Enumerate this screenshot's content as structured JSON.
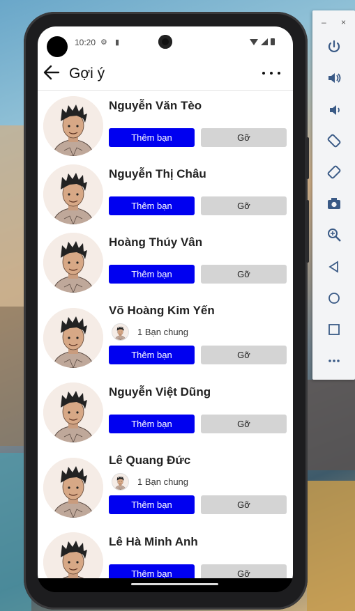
{
  "status_bar": {
    "time": "10:20"
  },
  "app_bar": {
    "title": "Gợi ý"
  },
  "suggestions": [
    {
      "name": "Nguyễn Văn Tèo",
      "mutual": null,
      "add_label": "Thêm bạn",
      "remove_label": "Gỡ"
    },
    {
      "name": "Nguyễn Thị Châu",
      "mutual": null,
      "add_label": "Thêm bạn",
      "remove_label": "Gỡ"
    },
    {
      "name": "Hoàng Thúy Vân",
      "mutual": null,
      "add_label": "Thêm bạn",
      "remove_label": "Gỡ"
    },
    {
      "name": "Võ Hoàng Kim Yến",
      "mutual": "1 Bạn chung",
      "add_label": "Thêm bạn",
      "remove_label": "Gỡ"
    },
    {
      "name": "Nguyễn Việt Dũng",
      "mutual": null,
      "add_label": "Thêm bạn",
      "remove_label": "Gỡ"
    },
    {
      "name": "Lê Quang Đức",
      "mutual": "1 Bạn chung",
      "add_label": "Thêm bạn",
      "remove_label": "Gỡ"
    },
    {
      "name": "Lê Hà Minh Anh",
      "mutual": null,
      "add_label": "Thêm bạn",
      "remove_label": "Gỡ"
    }
  ],
  "colors": {
    "add_button": "#0000f0",
    "remove_button": "#d4d4d4"
  },
  "emulator_toolbar": {
    "minimize": "–",
    "close": "×",
    "tools": [
      "power-icon",
      "volume-up-icon",
      "volume-down-icon",
      "rotate-left-icon",
      "rotate-right-icon",
      "camera-icon",
      "zoom-icon",
      "back-icon",
      "home-icon",
      "overview-icon",
      "more-icon"
    ]
  }
}
